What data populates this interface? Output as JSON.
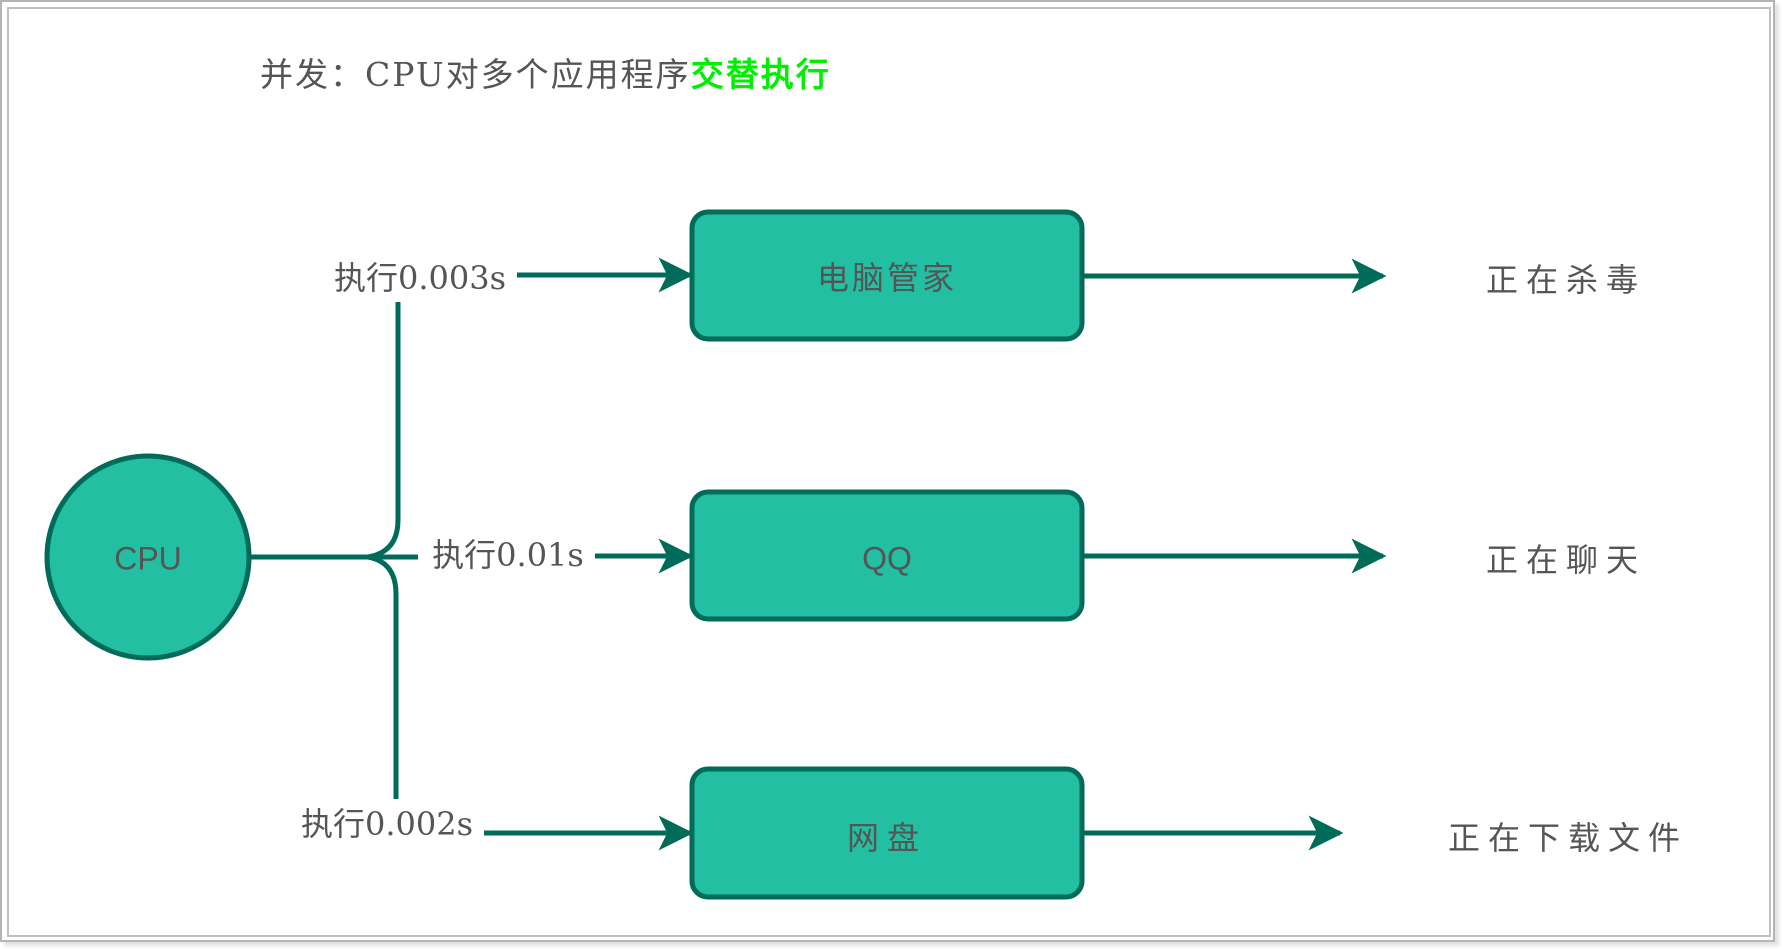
{
  "title": {
    "prefix": "并发：CPU对多个应用程序",
    "highlight": "交替执行"
  },
  "colors": {
    "node_fill": "#22bfa2",
    "node_stroke": "#006b58",
    "edge": "#006b58",
    "text": "#555555",
    "highlight": "#00ee00"
  },
  "cpu": {
    "label": "CPU"
  },
  "processes": [
    {
      "time_label": "执行0.003s",
      "app": "电脑管家",
      "status": "正在杀毒"
    },
    {
      "time_label": "执行0.01s",
      "app": "QQ",
      "status": "正在聊天"
    },
    {
      "time_label": "执行0.002s",
      "app": "网盘",
      "status": "正在下载文件"
    }
  ]
}
